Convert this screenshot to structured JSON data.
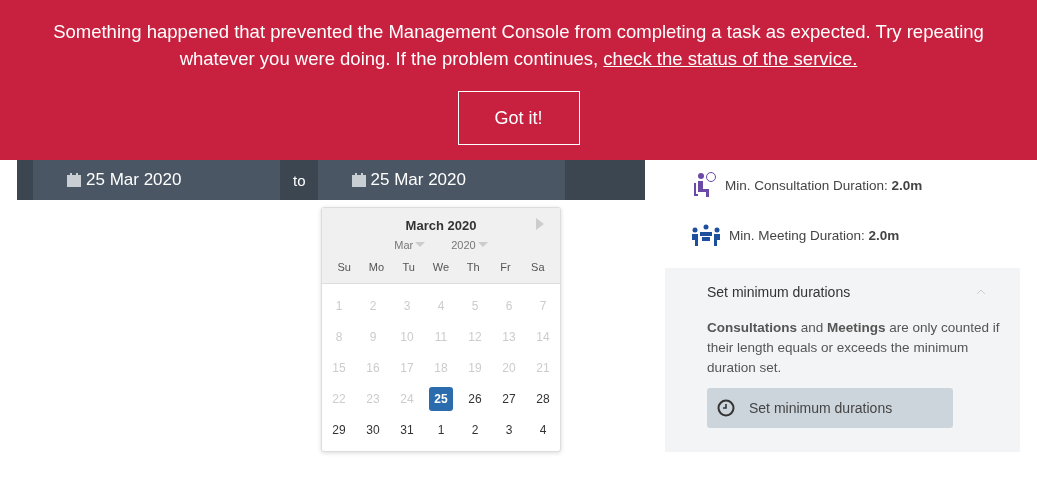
{
  "banner": {
    "message": "Something happened that prevented the Management Console from completing a task as expected. Try repeating whatever you were doing. If the problem continues,",
    "link": "check the status of the service.",
    "button": "Got it!"
  },
  "date_range": {
    "from": "25 Mar 2020",
    "separator": "to",
    "to": "25 Mar 2020"
  },
  "calendar": {
    "title": "March 2020",
    "month_select": "Mar",
    "year_select": "2020",
    "weekdays": [
      "Su",
      "Mo",
      "Tu",
      "We",
      "Th",
      "Fr",
      "Sa"
    ],
    "days": [
      {
        "label": "1",
        "disabled": true,
        "selected": false
      },
      {
        "label": "2",
        "disabled": true,
        "selected": false
      },
      {
        "label": "3",
        "disabled": true,
        "selected": false
      },
      {
        "label": "4",
        "disabled": true,
        "selected": false
      },
      {
        "label": "5",
        "disabled": true,
        "selected": false
      },
      {
        "label": "6",
        "disabled": true,
        "selected": false
      },
      {
        "label": "7",
        "disabled": true,
        "selected": false
      },
      {
        "label": "8",
        "disabled": true,
        "selected": false
      },
      {
        "label": "9",
        "disabled": true,
        "selected": false
      },
      {
        "label": "10",
        "disabled": true,
        "selected": false
      },
      {
        "label": "11",
        "disabled": true,
        "selected": false
      },
      {
        "label": "12",
        "disabled": true,
        "selected": false
      },
      {
        "label": "13",
        "disabled": true,
        "selected": false
      },
      {
        "label": "14",
        "disabled": true,
        "selected": false
      },
      {
        "label": "15",
        "disabled": true,
        "selected": false
      },
      {
        "label": "16",
        "disabled": true,
        "selected": false
      },
      {
        "label": "17",
        "disabled": true,
        "selected": false
      },
      {
        "label": "18",
        "disabled": true,
        "selected": false
      },
      {
        "label": "19",
        "disabled": true,
        "selected": false
      },
      {
        "label": "20",
        "disabled": true,
        "selected": false
      },
      {
        "label": "21",
        "disabled": true,
        "selected": false
      },
      {
        "label": "22",
        "disabled": true,
        "selected": false
      },
      {
        "label": "23",
        "disabled": true,
        "selected": false
      },
      {
        "label": "24",
        "disabled": true,
        "selected": false
      },
      {
        "label": "25",
        "disabled": false,
        "selected": true
      },
      {
        "label": "26",
        "disabled": false,
        "selected": false
      },
      {
        "label": "27",
        "disabled": false,
        "selected": false
      },
      {
        "label": "28",
        "disabled": false,
        "selected": false
      },
      {
        "label": "29",
        "disabled": false,
        "selected": false
      },
      {
        "label": "30",
        "disabled": false,
        "selected": false
      },
      {
        "label": "31",
        "disabled": false,
        "selected": false
      },
      {
        "label": "1",
        "disabled": false,
        "selected": false
      },
      {
        "label": "2",
        "disabled": false,
        "selected": false
      },
      {
        "label": "3",
        "disabled": false,
        "selected": false
      },
      {
        "label": "4",
        "disabled": false,
        "selected": false
      }
    ]
  },
  "durations": [
    {
      "kind": "consultation",
      "text": "Min. Consultation Duration: **2.0m**"
    },
    {
      "kind": "meeting",
      "text": "Min. Meeting Duration: **2.0m**"
    }
  ],
  "settings_panel": {
    "title": "Set minimum durations",
    "expanded": true,
    "description": "**Consultations** and **Meetings** are only counted if their length equals or exceeds the minimum duration set.",
    "button": "Set minimum durations"
  }
}
